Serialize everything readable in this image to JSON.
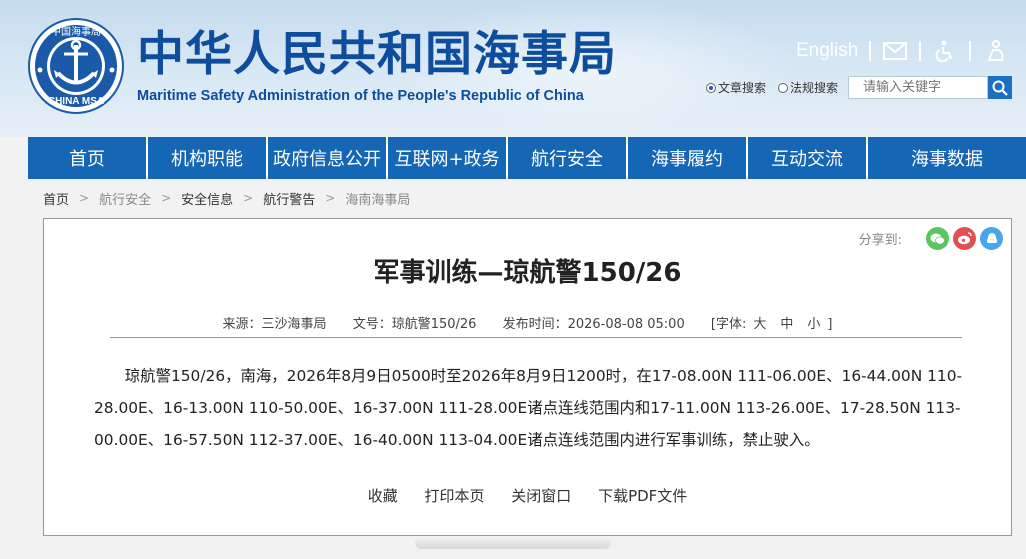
{
  "header": {
    "logo": {
      "ring_text_top": "中国海事局",
      "ring_text_bottom": "CHINA MSA"
    },
    "title_cn": "中华人民共和国海事局",
    "title_en": "Maritime Safety Administration of the People's Republic of China",
    "english_link": "English",
    "icons": [
      "mail-icon",
      "accessibility-icon",
      "elder-care-icon"
    ]
  },
  "search": {
    "option1": "文章搜索",
    "option2": "法规搜索",
    "placeholder": "请输入关键字"
  },
  "nav": {
    "items": [
      "首页",
      "机构职能",
      "政府信息公开",
      "互联网+政务",
      "航行安全",
      "海事履约",
      "互动交流",
      "海事数据"
    ]
  },
  "breadcrumb": {
    "items": [
      "首页",
      "航行安全",
      "安全信息",
      "航行警告",
      "海南海事局"
    ],
    "separator": ">"
  },
  "article": {
    "share_label": "分享到:",
    "title": "军事训练—琼航警150/26",
    "meta": {
      "source": "来源：三沙海事局",
      "doc_no": "文号：琼航警150/26",
      "published": "发布时间：2026-08-08 05:00",
      "font_label": "[字体:",
      "font_large": "大",
      "font_medium": "中",
      "font_small": "小",
      "font_close": "]"
    },
    "body": "琼航警150/26，南海，2026年8月9日0500时至2026年8月9日1200时，在17-08.00N 111-06.00E、16-44.00N 110-28.00E、16-13.00N 110-50.00E、16-37.00N 111-28.00E诸点连线范围内和17-11.00N 113-26.00E、17-28.50N 113-00.00E、16-57.50N 112-37.00E、16-40.00N 113-04.00E诸点连线范围内进行军事训练，禁止驶入。",
    "actions": {
      "favorite": "收藏",
      "print": "打印本页",
      "close": "关闭窗口",
      "download": "下载PDF文件"
    }
  },
  "colors": {
    "brand_blue": "#0e4d9e",
    "nav_blue": "#1666b6",
    "wechat": "#5cc55f",
    "weibo": "#e45050",
    "qq": "#4aa6ea"
  }
}
